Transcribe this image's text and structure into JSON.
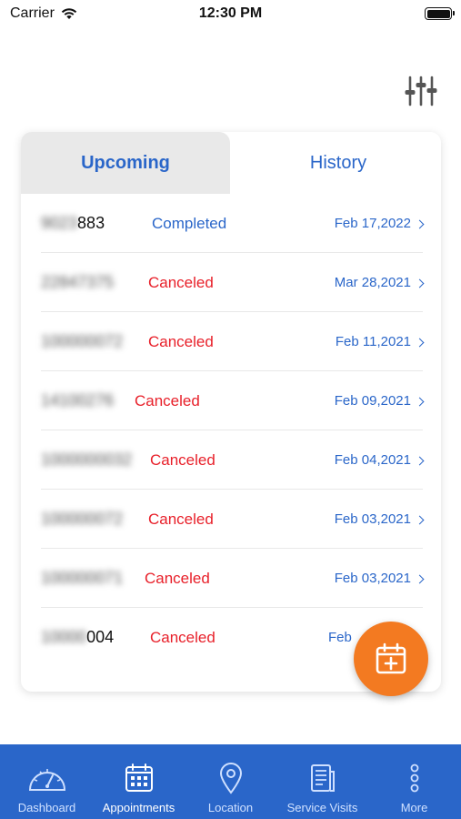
{
  "status_bar": {
    "carrier": "Carrier",
    "time": "12:30 PM"
  },
  "tabs": [
    {
      "label": "Upcoming",
      "selected": false
    },
    {
      "label": "History",
      "selected": true
    }
  ],
  "appointments": [
    {
      "id_visible": "883",
      "status": "Completed",
      "date": "Feb 17,2022"
    },
    {
      "id_visible": "",
      "status": "Canceled",
      "date": "Mar 28,2021"
    },
    {
      "id_visible": "",
      "status": "Canceled",
      "date": "Feb 11,2021"
    },
    {
      "id_visible": "",
      "status": "Canceled",
      "date": "Feb 09,2021"
    },
    {
      "id_visible": "",
      "status": "Canceled",
      "date": "Feb 04,2021"
    },
    {
      "id_visible": "",
      "status": "Canceled",
      "date": "Feb 03,2021"
    },
    {
      "id_visible": "",
      "status": "Canceled",
      "date": "Feb 03,2021"
    },
    {
      "id_visible": "004",
      "status": "Canceled",
      "date": "Feb"
    }
  ],
  "nav": [
    {
      "label": "Dashboard",
      "icon": "speedometer-icon",
      "active": false
    },
    {
      "label": "Appointments",
      "icon": "calendar-icon",
      "active": true
    },
    {
      "label": "Location",
      "icon": "map-pin-icon",
      "active": false
    },
    {
      "label": "Service Visits",
      "icon": "document-icon",
      "active": false
    },
    {
      "label": "More",
      "icon": "more-vertical-icon",
      "active": false
    }
  ],
  "colors": {
    "accent": "#2a66c9",
    "completed": "#2a66c9",
    "canceled": "#e8202a",
    "fab": "#f37a21",
    "tabbar": "#2a66c9"
  }
}
